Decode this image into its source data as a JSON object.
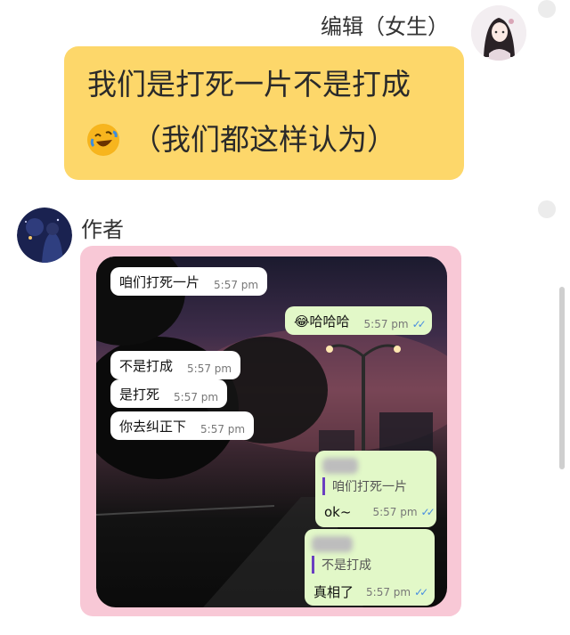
{
  "editor_message": {
    "name": "编辑（女生）",
    "line1": "我们是打死一片不是打成",
    "line2": "（我们都这样认为）",
    "emoji": "rolling-on-floor-laughing-emoji"
  },
  "author_message": {
    "name": "作者"
  },
  "chat_screenshot": {
    "messages": [
      {
        "text": "咱们打死一片",
        "time": "5:57 pm"
      },
      {
        "text": "😂哈哈哈",
        "time": "5:57 pm",
        "read": "✓✓"
      },
      {
        "text": "不是打成",
        "time": "5:57 pm"
      },
      {
        "text": "是打死",
        "time": "5:57 pm"
      },
      {
        "text": "你去纠正下",
        "time": "5:57 pm"
      },
      {
        "quote": "咱们打死一片",
        "text": "ok~",
        "time": "5:57 pm",
        "read": "✓✓"
      },
      {
        "quote": "不是打成",
        "text": "真相了",
        "time": "5:57 pm",
        "read": "✓✓"
      }
    ]
  },
  "colors": {
    "yellow_bubble": "#fdd76a",
    "pink_frame": "#f8c8d6",
    "green_bubble": "#e2f8c8",
    "read_tick": "#4a8fe0"
  }
}
